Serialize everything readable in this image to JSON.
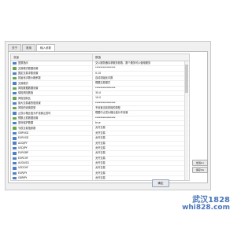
{
  "tabs": [
    "关于",
    "常用",
    "输入参数"
  ],
  "columns": [
    "变量",
    "数值"
  ],
  "rows": [
    {
      "name": "盈数指示",
      "value": "交以服务器请求服务参数，数个服务可以使用服务",
      "icon": "blue"
    },
    {
      "name": "交易模式数据设置",
      "value": "****************",
      "icon": "green"
    },
    {
      "name": "固定交易手数设置",
      "value": "0.10",
      "icon": "blue"
    },
    {
      "name": "初始化手数价格系数",
      "value": "自动初始化手数",
      "icon": "green"
    },
    {
      "name": "交易模式",
      "value": "根据交易模式",
      "icon": "blue"
    },
    {
      "name": "风险数据数据设置",
      "value": "****************",
      "icon": "green"
    },
    {
      "name": "保险风险数值",
      "value": "35.0",
      "icon": "blue"
    },
    {
      "name": "风险控制比",
      "value": "10.0",
      "icon": "green"
    },
    {
      "name": "最大交易者的值设置",
      "value": "****************",
      "icon": "blue"
    },
    {
      "name": "风险的设置类型",
      "value": "不设置当前风险的类型",
      "icon": "green"
    },
    {
      "name": "止损价格比值为不设置止损时",
      "value": "根据中止损价格比值为不设置",
      "icon": "blue"
    },
    {
      "name": "预数止损数据设置",
      "value": "****************",
      "icon": "green"
    },
    {
      "name": "盈利保护数据",
      "value": "true",
      "icon": "blue"
    },
    {
      "name": "亏损交易值参数",
      "value": "允许交易",
      "icon": "green"
    },
    {
      "name": "GBPUSD",
      "value": "允许交易",
      "icon": "blue"
    },
    {
      "name": "EURUSD",
      "value": "允许交易",
      "icon": "blue"
    },
    {
      "name": "AUDJPY",
      "value": "允许交易",
      "icon": "blue"
    },
    {
      "name": "USDJPY",
      "value": "允许交易",
      "icon": "blue"
    },
    {
      "name": "EURGBP",
      "value": "允许交易",
      "icon": "blue"
    },
    {
      "name": "EURCHF",
      "value": "允许交易",
      "icon": "blue"
    },
    {
      "name": "AUDUSD",
      "value": "允许交易",
      "icon": "blue"
    },
    {
      "name": "USDCHF",
      "value": "允许交易",
      "icon": "blue"
    },
    {
      "name": "EURJPY",
      "value": "允许交易",
      "icon": "blue"
    },
    {
      "name": "GBPJPY",
      "value": "允许交易",
      "icon": "blue"
    },
    {
      "name": "NZDUSD",
      "value": "允许交易",
      "icon": "blue"
    },
    {
      "name": "USDCAD",
      "value": "允许交易",
      "icon": "blue"
    },
    {
      "name": "EURAUD",
      "value": "允许交易",
      "icon": "blue"
    },
    {
      "name": "EURCAD",
      "value": "允许交易",
      "icon": "blue"
    }
  ],
  "buttons": {
    "load": "加载(L)",
    "save": "保存(S)",
    "ok": "确定"
  },
  "watermark": {
    "line1": "武汉1828",
    "line2": "whi828.com"
  }
}
